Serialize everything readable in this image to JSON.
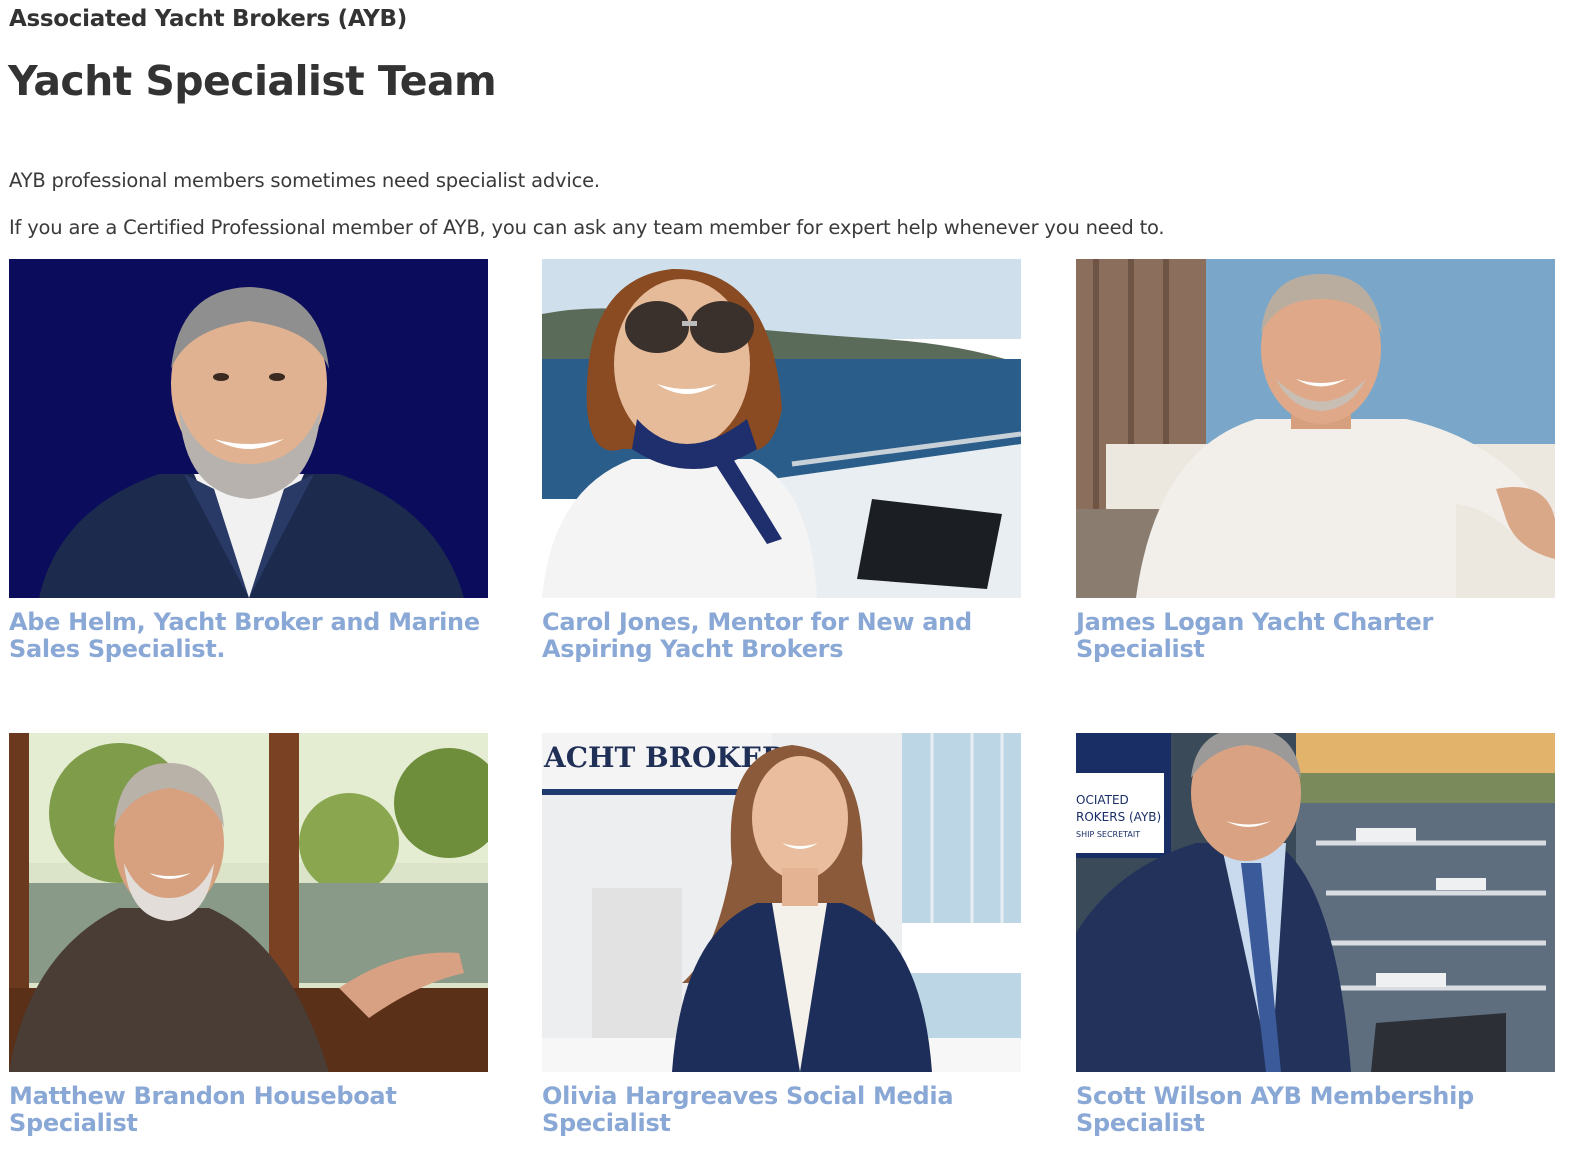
{
  "header": {
    "site_name": "Associated Yacht Brokers (AYB)",
    "page_title": "Yacht Specialist Team"
  },
  "intro": {
    "line1": "AYB professional members sometimes need specialist advice.",
    "line2": "If you are a Certified Professional member of AYB, you can ask any team member for expert help whenever you need to."
  },
  "colors": {
    "caption_link": "#8aa8d6",
    "heading_text": "#333333"
  },
  "team": [
    {
      "caption": "Abe Helm, Yacht Broker and Marine Sales Specialist."
    },
    {
      "caption": "Carol Jones, Mentor for New and Aspiring Yacht Brokers"
    },
    {
      "caption": "James Logan Yacht Charter Specialist"
    },
    {
      "caption": "Matthew Brandon Houseboat Specialist"
    },
    {
      "caption": "Olivia Hargreaves Social Media Specialist"
    },
    {
      "caption": "Scott Wilson AYB Membership Specialist"
    }
  ],
  "photo_signage": {
    "olivia_sign": "ACHT BROKERS",
    "scott_sign_line1": "OCIATED",
    "scott_sign_line2": "ROKERS (AYB)",
    "scott_sign_line3": "SHIP SECRETAIT"
  }
}
